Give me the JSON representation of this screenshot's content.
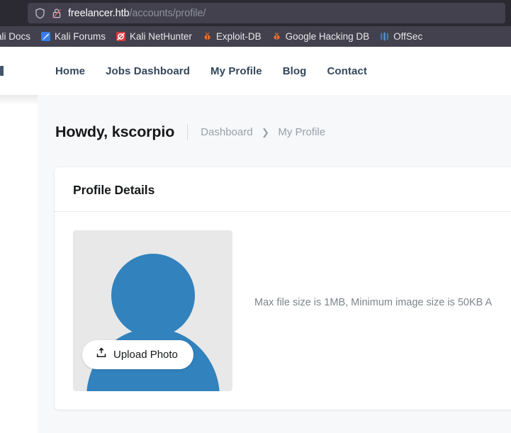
{
  "browser": {
    "shield_icon": "shield-icon",
    "insecure_lock_icon": "lock-crossed-icon",
    "url_host": "freelancer.htb",
    "url_path": "/accounts/profile/",
    "bookmarks": [
      {
        "label": "ali Docs",
        "icon": "kali-docs-icon"
      },
      {
        "label": "Kali Forums",
        "icon": "kali-forums-icon"
      },
      {
        "label": "Kali NetHunter",
        "icon": "kali-nethunter-icon"
      },
      {
        "label": "Exploit-DB",
        "icon": "exploit-db-icon"
      },
      {
        "label": "Google Hacking DB",
        "icon": "google-hacking-db-icon"
      },
      {
        "label": "OffSec",
        "icon": "offsec-icon"
      }
    ]
  },
  "site": {
    "nav": [
      {
        "label": "Home"
      },
      {
        "label": "Jobs Dashboard"
      },
      {
        "label": "My Profile"
      },
      {
        "label": "Blog"
      },
      {
        "label": "Contact"
      }
    ]
  },
  "hero": {
    "greeting": "Howdy, kscorpio",
    "breadcrumb_root": "Dashboard",
    "breadcrumb_chevron": "❯",
    "breadcrumb_current": "My Profile"
  },
  "card": {
    "title": "Profile Details",
    "upload_button_label": "Upload Photo",
    "upload_icon": "upload-tray-icon",
    "help_text": "Max file size is 1MB, Minimum image size is 50KB A",
    "avatar_icon": "user-avatar-placeholder-icon"
  },
  "colors": {
    "chrome_bg": "#2b2a33",
    "urlbar_bg": "#42414d",
    "bookmarks_bg": "#42414d",
    "nav_text": "#33475b",
    "avatar_blue": "#3182bd",
    "content_bg": "#f7f8f9",
    "muted_text": "#7d858d"
  }
}
